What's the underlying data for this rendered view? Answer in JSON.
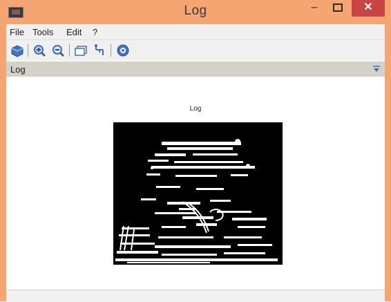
{
  "window": {
    "title": "Log"
  },
  "titlebar_buttons": {
    "minimize": "–",
    "close": "✕"
  },
  "menu": [
    "File",
    "Tools",
    "Edit",
    "?"
  ],
  "toolbar": {
    "tools": [
      "save-icon",
      "zoom-in-icon",
      "zoom-out-icon",
      "pan-icon",
      "datatip-icon",
      "help-icon"
    ]
  },
  "panel": {
    "title": "Log"
  },
  "plot": {
    "title": "Log",
    "image_description_visible": false
  },
  "colors": {
    "titlebar": "#f4a571",
    "close": "#c94444",
    "panel_header": "#d4d1c8"
  }
}
